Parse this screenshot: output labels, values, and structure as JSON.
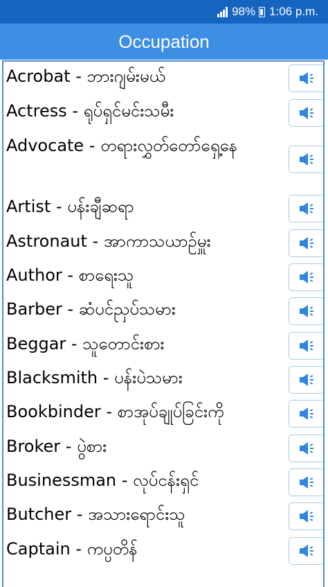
{
  "status_bar": {
    "battery": "98%",
    "time": "1:06 p.m."
  },
  "header": {
    "title": "Occupation"
  },
  "icons": {
    "speaker": "speaker-volume-icon",
    "signal": "signal-bars-icon",
    "battery": "battery-icon"
  },
  "colors": {
    "status_bar": "#1565c0",
    "title_bar": "#3d8fe3",
    "list_border": "#4a90d9",
    "speaker_icon": "#2e86de"
  },
  "items": [
    {
      "text": " Acrobat - ဘားဂျမ်းမယ်"
    },
    {
      "text": "Actress - ရုပ်ရှင်မင်းသမီး"
    },
    {
      "text": "Advocate - တရားလွှတ်တော်ရှေ့နေ"
    },
    {
      "text": "Artist - ပန်းချီဆရာ"
    },
    {
      "text": "Astronaut - အာကာသယာဉ်မှူး"
    },
    {
      "text": "Author - စာရေးသူ"
    },
    {
      "text": "Barber - ဆံပင်ညှပ်သမား"
    },
    {
      "text": "Beggar - သူတောင်းစား"
    },
    {
      "text": "Blacksmith - ပန်းပဲသမား"
    },
    {
      "text": "Bookbinder - စာအုပ်ချုပ်ခြင်းကို"
    },
    {
      "text": "Broker - ပွဲစား"
    },
    {
      "text": "Businessman - လုပ်ငန်းရှင်"
    },
    {
      "text": "Butcher - အသားရောင်းသူ"
    },
    {
      "text": "Captain - ကပ္ပတိန်"
    }
  ]
}
